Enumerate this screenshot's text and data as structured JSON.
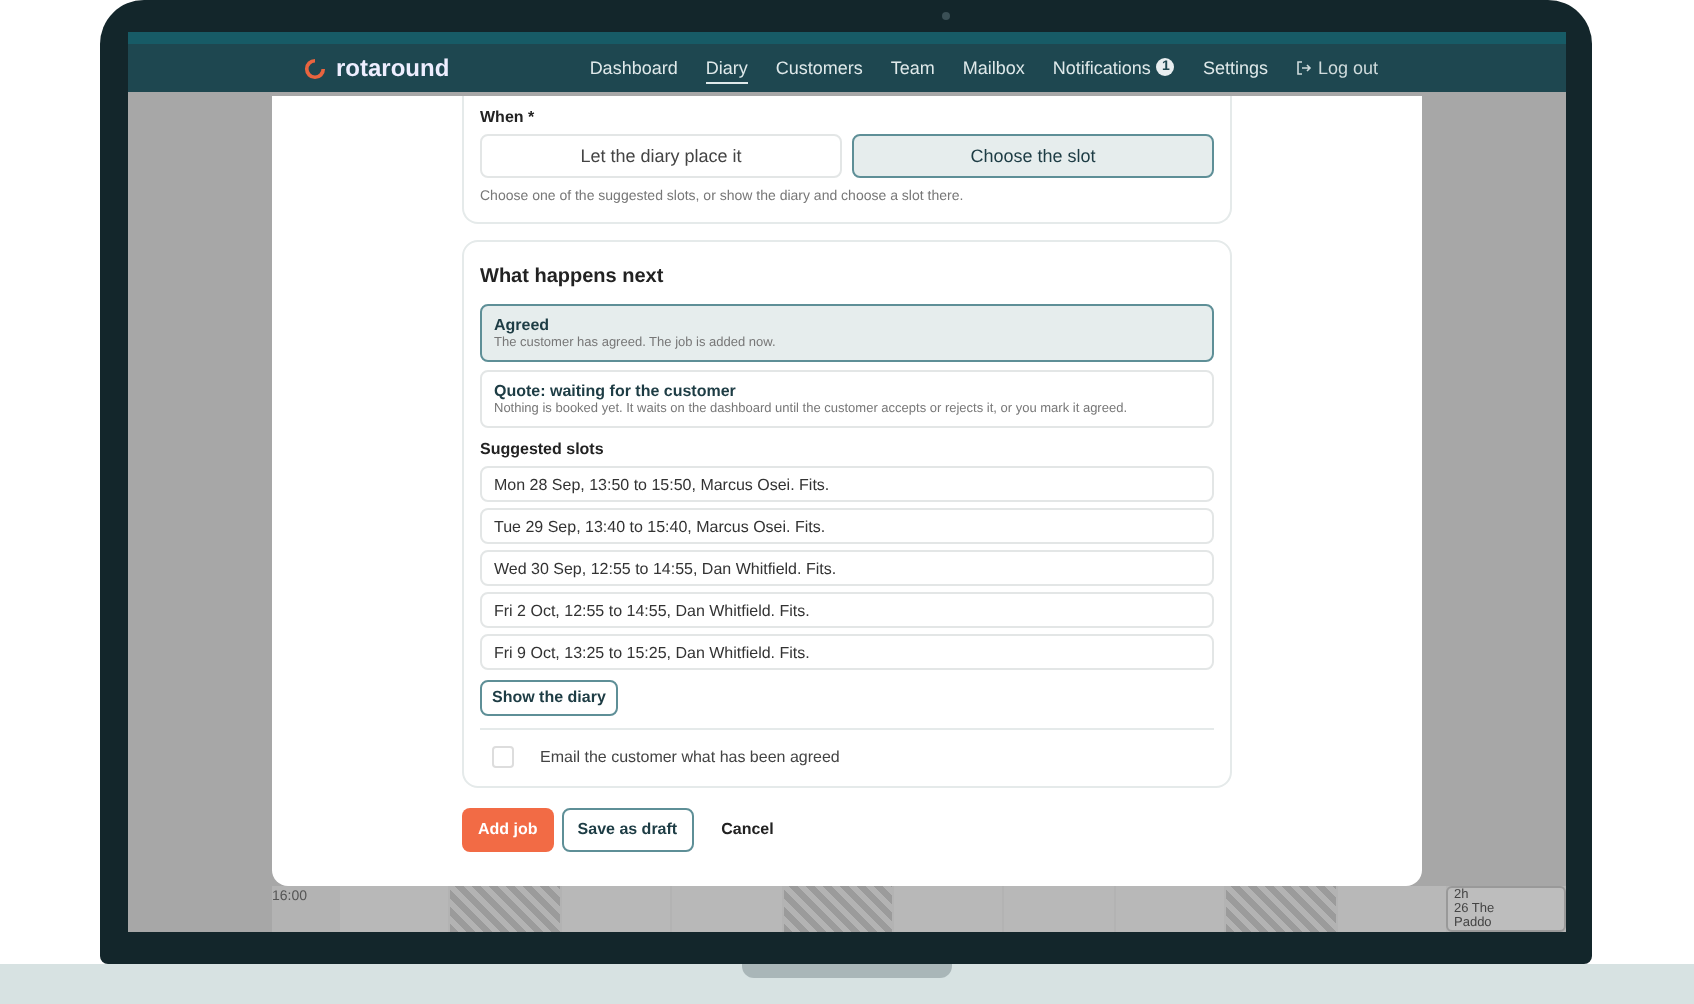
{
  "nav": {
    "brand": "rotaround",
    "items": [
      {
        "label": "Dashboard",
        "selected": false
      },
      {
        "label": "Diary",
        "selected": true
      },
      {
        "label": "Customers",
        "selected": false
      },
      {
        "label": "Team",
        "selected": false
      },
      {
        "label": "Mailbox",
        "selected": false
      },
      {
        "label": "Notifications",
        "selected": false,
        "badge": "1"
      },
      {
        "label": "Settings",
        "selected": false
      }
    ],
    "logout": "Log out"
  },
  "when": {
    "label": "When *",
    "options": [
      {
        "label": "Let the diary place it",
        "selected": false
      },
      {
        "label": "Choose the slot",
        "selected": true
      }
    ],
    "hint": "Choose one of the suggested slots, or show the diary and choose a slot there."
  },
  "next": {
    "title": "What happens next",
    "options": [
      {
        "title": "Agreed",
        "description": "The customer has agreed. The job is added now.",
        "selected": true
      },
      {
        "title": "Quote: waiting for the customer",
        "description": "Nothing is booked yet. It waits on the dashboard until the customer accepts or rejects it, or you mark it agreed.",
        "selected": false
      }
    ],
    "slots_label": "Suggested slots",
    "slots": [
      {
        "text": "Mon 28 Sep, 13:50 to 15:50, Marcus Osei. Fits.",
        "selected": false
      },
      {
        "text": "Tue 29 Sep, 13:40 to 15:40, Marcus Osei. Fits.",
        "selected": false
      },
      {
        "text": "Wed 30 Sep, 12:55 to 14:55, Dan Whitfield. Fits.",
        "selected": false
      },
      {
        "text": "Fri 2 Oct, 12:55 to 14:55, Dan Whitfield. Fits.",
        "selected": false
      },
      {
        "text": "Fri 9 Oct, 13:25 to 15:25, Dan Whitfield. Fits.",
        "selected": false
      }
    ],
    "show_diary": "Show the diary",
    "email": {
      "label": "Email the customer what has been agreed",
      "checked": false
    }
  },
  "actions": [
    {
      "label": "Add job",
      "kind": "primary"
    },
    {
      "label": "Save as draft",
      "kind": "secondary"
    },
    {
      "label": "Cancel",
      "kind": "plain"
    }
  ],
  "diary": {
    "time_label": "16:00",
    "event_lines": [
      "2h",
      "26 The",
      "Paddo"
    ]
  }
}
